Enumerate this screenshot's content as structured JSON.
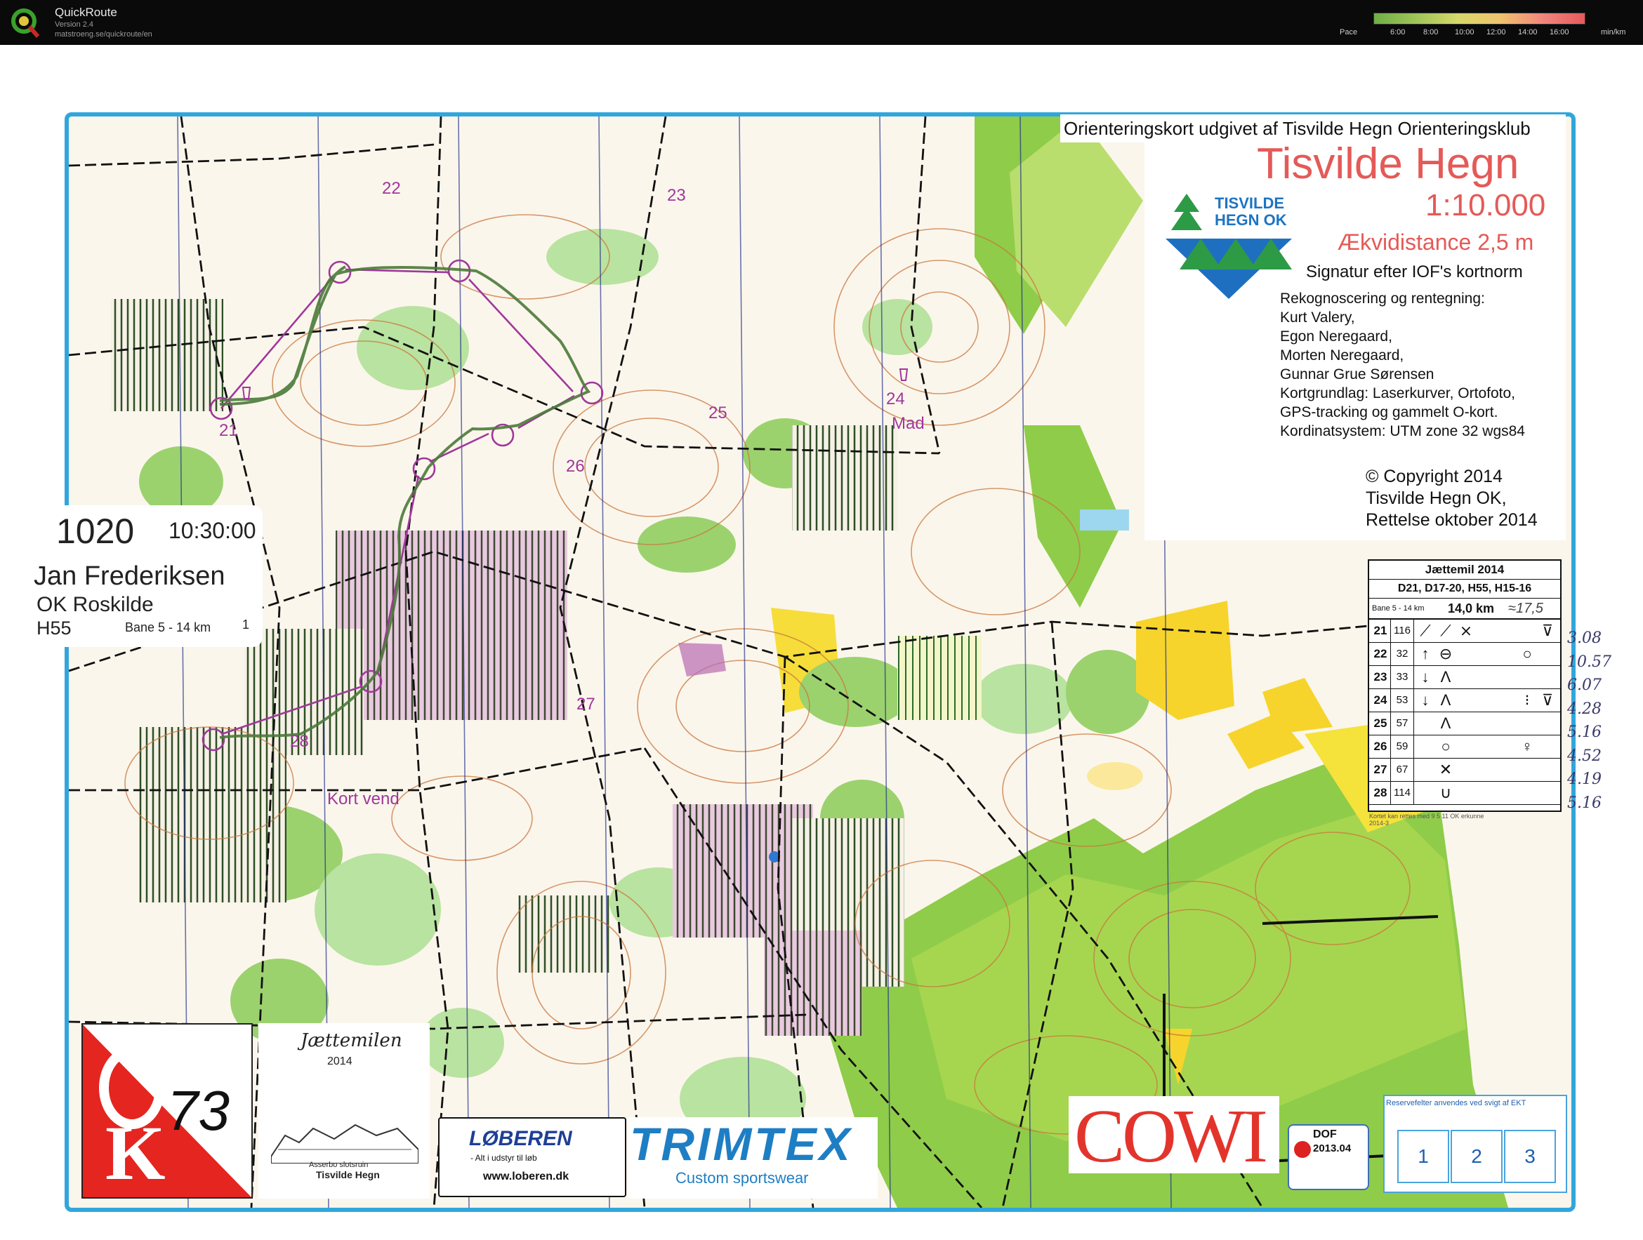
{
  "app": {
    "name": "QuickRoute",
    "version": "Version 2.4",
    "url": "matstroeng.se/quickroute/en",
    "pace_label": "Pace",
    "pace_ticks": [
      "6:00",
      "8:00",
      "10:00",
      "12:00",
      "14:00",
      "16:00"
    ],
    "pace_unit": "min/km"
  },
  "map": {
    "header": "Orienteringskort udgivet af Tisvilde Hegn Orienteringsklub",
    "title": "Tisvilde Hegn",
    "scale": "1:10.000",
    "equidistance": "Ækvidistance 2,5 m",
    "symbology": "Signatur efter IOF's kortnorm",
    "credits": [
      "Rekognoscering og rentegning:",
      "Kurt Valery,",
      "Egon Neregaard,",
      "Morten Neregaard,",
      "Gunnar Grue Sørensen",
      "Kortgrundlag:   Laserkurver, Ortofoto,",
      "GPS-tracking og gammelt O-kort.",
      "Kordinatsystem: UTM zone 32 wgs84"
    ],
    "copyright": [
      "© Copyright 2014",
      "Tisvilde Hegn OK,",
      "Rettelse oktober 2014"
    ],
    "club_logo": [
      "TISVILDE",
      "HEGN OK"
    ],
    "controls": [
      {
        "label": "21"
      },
      {
        "label": "22"
      },
      {
        "label": "23"
      },
      {
        "label": "24"
      },
      {
        "label": "25"
      },
      {
        "label": "26"
      },
      {
        "label": "27"
      },
      {
        "label": "28"
      }
    ],
    "place_labels": [
      "Mad",
      "Kort vend"
    ],
    "colors": {
      "frame": "#31a6dc",
      "course": "#a0379b",
      "route": "#4b7a3a",
      "title": "#e45a57"
    }
  },
  "runner": {
    "number": "1020",
    "start_time": "10:30:00",
    "name": "Jan Frederiksen",
    "club": "OK Roskilde",
    "class": "H55",
    "course": "Bane 5 - 14 km",
    "course_no": "1"
  },
  "control_description": {
    "event": "Jættemil 2014",
    "classes": "D21, D17-20, H55, H15-16",
    "course_name": "Bane 5 - 14 km",
    "length": "14,0 km",
    "handwritten_length": "≈17,5",
    "rows": [
      {
        "no": "21",
        "code": "116",
        "symbols": [
          "⟋",
          "⟋",
          "⨯",
          "",
          "",
          "",
          "⊽"
        ]
      },
      {
        "no": "22",
        "code": "32",
        "symbols": [
          "↑",
          "⊖",
          "",
          "",
          "",
          "○",
          ""
        ]
      },
      {
        "no": "23",
        "code": "33",
        "symbols": [
          "↓",
          "Λ",
          "",
          "",
          "",
          "",
          ""
        ]
      },
      {
        "no": "24",
        "code": "53",
        "symbols": [
          "↓",
          "Λ",
          "",
          "",
          "",
          "⁝",
          "⊽"
        ]
      },
      {
        "no": "25",
        "code": "57",
        "symbols": [
          "",
          "Λ",
          "",
          "",
          "",
          "",
          ""
        ]
      },
      {
        "no": "26",
        "code": "59",
        "symbols": [
          "",
          "○",
          "",
          "",
          "",
          "♀",
          ""
        ]
      },
      {
        "no": "27",
        "code": "67",
        "symbols": [
          "",
          "✕",
          "",
          "",
          "",
          "",
          ""
        ]
      },
      {
        "no": "28",
        "code": "114",
        "symbols": [
          "",
          "∪",
          "",
          "",
          "",
          "",
          ""
        ]
      }
    ],
    "footnote": [
      "Kortet kan rettes med 9 5 11 OK erkunne",
      "2014-3"
    ]
  },
  "splits": [
    "3.08",
    "10.57",
    "6.07",
    "4.28",
    "5.16",
    "4.52",
    "4.19",
    "5.16"
  ],
  "sponsors": {
    "ok73": "OK73",
    "jaettemilen": {
      "title": "Jættemilen",
      "year": "2014",
      "caption1": "Asserbo slotsruin",
      "caption2": "Tisvilde Hegn"
    },
    "loberen": {
      "name": "LØBEREN",
      "tagline": "- Alt i udstyr til løb",
      "url": "www.loberen.dk"
    },
    "trimtex": {
      "name": "TRIMTEX",
      "tagline": "Custom sportswear"
    },
    "cowi": "COWI",
    "dof": {
      "label": "DOF",
      "id": "2013.04"
    },
    "reserve": {
      "title": "Reservefelter anvendes ved svigt af EKT",
      "boxes": [
        "1",
        "2",
        "3"
      ]
    }
  }
}
